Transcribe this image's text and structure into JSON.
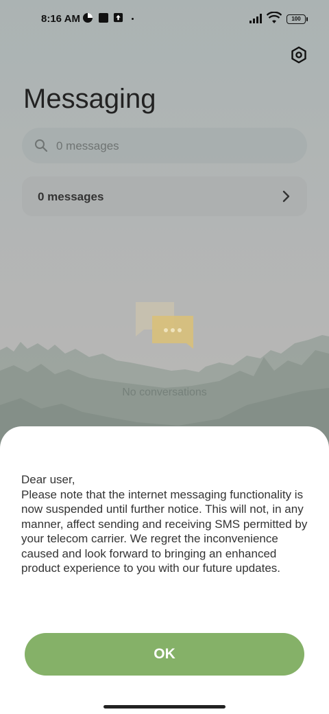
{
  "status_bar": {
    "time": "8:16 AM",
    "battery": "100",
    "icons": [
      "vpn-icon",
      "notification-square-icon",
      "upload-icon",
      "dot-icon",
      "signal-icon",
      "wifi-icon",
      "battery-icon"
    ]
  },
  "header": {
    "title": "Messaging",
    "settings_icon": "settings-hexagon-icon"
  },
  "search": {
    "placeholder": "0 messages",
    "icon": "search-icon"
  },
  "messages_card": {
    "label": "0 messages",
    "icon": "chevron-right-icon"
  },
  "empty_state": {
    "icon": "chat-bubbles-icon",
    "text": "No conversations"
  },
  "dialog": {
    "greeting": "Dear user,",
    "body": "Please note that the internet messaging functionality is now suspended until further notice. This will not, in any manner, affect sending and receiving SMS permitted by your telecom carrier. We regret the inconvenience caused and look forward to bringing an enhanced product experience to you with our future updates.",
    "ok_label": "OK"
  },
  "colors": {
    "accent": "#85b168",
    "sheet": "#ffffff"
  }
}
